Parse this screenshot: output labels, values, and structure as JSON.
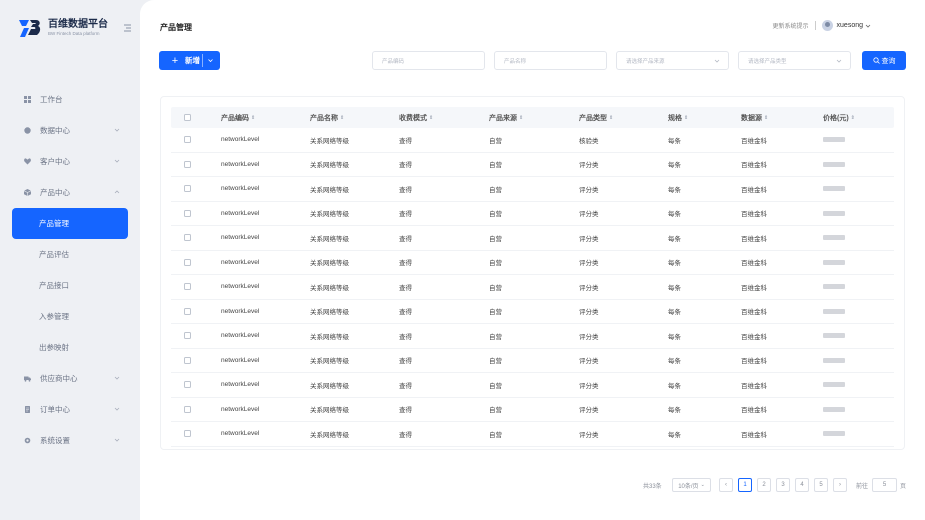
{
  "app": {
    "title": "百维数据平台",
    "subtitle": "BW Fintech Data platform"
  },
  "sidebar": {
    "items": [
      {
        "label": "工作台",
        "icon": "dashboard-icon"
      },
      {
        "label": "数据中心",
        "icon": "database-icon"
      },
      {
        "label": "客户中心",
        "icon": "heart-icon"
      },
      {
        "label": "产品中心",
        "icon": "cube-icon"
      },
      {
        "label": "产品管理"
      },
      {
        "label": "产品评估"
      },
      {
        "label": "产品接口"
      },
      {
        "label": "入参管理"
      },
      {
        "label": "出参映射"
      },
      {
        "label": "供应商中心",
        "icon": "truck-icon"
      },
      {
        "label": "订单中心",
        "icon": "document-icon"
      },
      {
        "label": "系统设置",
        "icon": "gear-icon"
      }
    ]
  },
  "header": {
    "page_title": "产品管理",
    "change_password": "更新系统提示",
    "username": "xuesong"
  },
  "toolbar": {
    "add_label": "新增",
    "filters": {
      "code_placeholder": "产品编码",
      "name_placeholder": "产品名称",
      "source_placeholder": "请选择产品来源",
      "type_placeholder": "请选择产品类型"
    },
    "search_label": "查询"
  },
  "table": {
    "columns": [
      "产品编码",
      "产品名称",
      "收费模式",
      "产品来源",
      "产品类型",
      "规格",
      "数据源",
      "价格(元)"
    ],
    "rows": [
      {
        "code": "networkLevel",
        "name": "关系网络等级",
        "charge": "查得",
        "source": "自营",
        "type": "核验类",
        "spec": "每条",
        "ds": "百维金科"
      },
      {
        "code": "networkLevel",
        "name": "关系网络等级",
        "charge": "查得",
        "source": "自营",
        "type": "评分类",
        "spec": "每条",
        "ds": "百维金科"
      },
      {
        "code": "networkLevel",
        "name": "关系网络等级",
        "charge": "查得",
        "source": "自营",
        "type": "评分类",
        "spec": "每条",
        "ds": "百维金科"
      },
      {
        "code": "networkLevel",
        "name": "关系网络等级",
        "charge": "查得",
        "source": "自营",
        "type": "评分类",
        "spec": "每条",
        "ds": "百维金科"
      },
      {
        "code": "networkLevel",
        "name": "关系网络等级",
        "charge": "查得",
        "source": "自营",
        "type": "评分类",
        "spec": "每条",
        "ds": "百维金科"
      },
      {
        "code": "networkLevel",
        "name": "关系网络等级",
        "charge": "查得",
        "source": "自营",
        "type": "评分类",
        "spec": "每条",
        "ds": "百维金科"
      },
      {
        "code": "networkLevel",
        "name": "关系网络等级",
        "charge": "查得",
        "source": "自营",
        "type": "评分类",
        "spec": "每条",
        "ds": "百维金科"
      },
      {
        "code": "networkLevel",
        "name": "关系网络等级",
        "charge": "查得",
        "source": "自营",
        "type": "评分类",
        "spec": "每条",
        "ds": "百维金科"
      },
      {
        "code": "networkLevel",
        "name": "关系网络等级",
        "charge": "查得",
        "source": "自营",
        "type": "评分类",
        "spec": "每条",
        "ds": "百维金科"
      },
      {
        "code": "networkLevel",
        "name": "关系网络等级",
        "charge": "查得",
        "source": "自营",
        "type": "评分类",
        "spec": "每条",
        "ds": "百维金科"
      },
      {
        "code": "networkLevel",
        "name": "关系网络等级",
        "charge": "查得",
        "source": "自营",
        "type": "评分类",
        "spec": "每条",
        "ds": "百维金科"
      },
      {
        "code": "networkLevel",
        "name": "关系网络等级",
        "charge": "查得",
        "source": "自营",
        "type": "评分类",
        "spec": "每条",
        "ds": "百维金科"
      },
      {
        "code": "networkLevel",
        "name": "关系网络等级",
        "charge": "查得",
        "source": "自营",
        "type": "评分类",
        "spec": "每条",
        "ds": "百维金科"
      }
    ]
  },
  "pagination": {
    "total": "共33条",
    "page_size": "10条/页",
    "pages": [
      "1",
      "2",
      "3",
      "4",
      "5"
    ],
    "current": "1",
    "goto_label": "前往",
    "goto_value": "5",
    "page_unit": "页"
  },
  "colors": {
    "accent": "#1565ff",
    "sidebar_bg": "#eef0f4"
  }
}
